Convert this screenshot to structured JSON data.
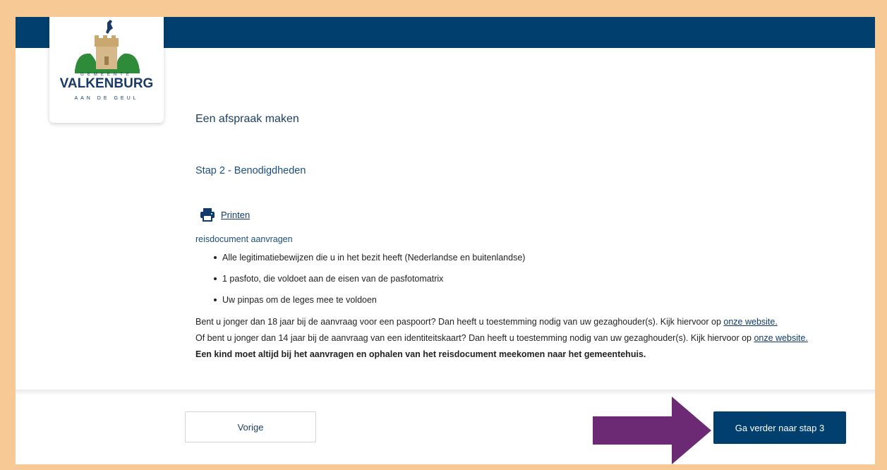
{
  "logo": {
    "small_text": "GEMEENTE",
    "name": "VALKENBURG",
    "subtitle": "AAN DE GEUL"
  },
  "page": {
    "title": "Een afspraak maken",
    "step_title": "Stap 2 - Benodigdheden",
    "print_label": "Printen",
    "section_label": "reisdocument aanvragen"
  },
  "requirements": [
    "Alle legitimatiebewijzen die u in het bezit heeft (Nederlandse en buitenlandse)",
    "1 pasfoto, die voldoet aan de eisen van de pasfotomatrix",
    "Uw pinpas om de leges mee te voldoen"
  ],
  "info": {
    "p1_text": "Bent u jonger dan 18 jaar bij de aanvraag voor een paspoort? Dan heeft u toestemming nodig van uw gezaghouder(s). Kijk hiervoor op ",
    "p1_link": "onze website.",
    "p2_text": "Of bent u jonger dan 14 jaar bij de aanvraag van een identiteitskaart? Dan heeft u toestemming nodig van uw gezaghouder(s). Kijk hiervoor op ",
    "p2_link": "onze website.",
    "p3_text": "Een kind moet altijd bij het aanvragen en ophalen van het reisdocument meekomen naar het gemeentehuis."
  },
  "nav": {
    "prev_label": "Vorige",
    "next_label": "Ga verder naar stap 3"
  },
  "colors": {
    "brand_blue": "#003f6e",
    "frame_border": "#f7c995",
    "arrow": "#6b2a73"
  }
}
